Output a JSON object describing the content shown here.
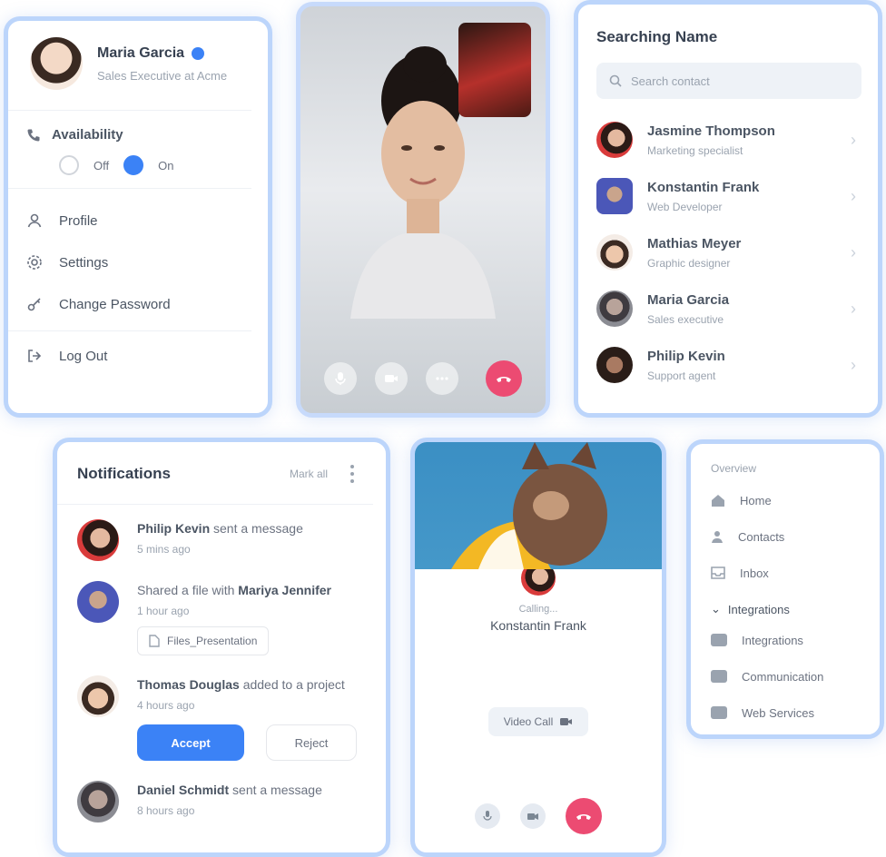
{
  "profile": {
    "name": "Maria Garcia",
    "subtitle": "Sales Executive at Acme",
    "availability_label": "Availability",
    "radio_off": "Off",
    "radio_on": "On",
    "menu": [
      "Profile",
      "Settings",
      "Change Password"
    ],
    "logout": "Log Out"
  },
  "contacts": {
    "title": "Searching Name",
    "search_placeholder": "Search contact",
    "items": [
      {
        "name": "Jasmine Thompson",
        "sub": "Marketing specialist"
      },
      {
        "name": "Konstantin Frank",
        "sub": "Web Developer"
      },
      {
        "name": "Mathias Meyer",
        "sub": "Graphic designer"
      },
      {
        "name": "Maria Garcia",
        "sub": "Sales executive"
      },
      {
        "name": "Philip Kevin",
        "sub": "Support agent"
      }
    ]
  },
  "notifications": {
    "title": "Notifications",
    "mark_all": "Mark all",
    "items": [
      {
        "actor": "Philip Kevin",
        "action": "sent a message",
        "time": "5 mins ago"
      },
      {
        "pre": "Shared a file with",
        "actor": "Mariya Jennifer",
        "time": "1 hour ago",
        "file": "Files_Presentation"
      },
      {
        "actor": "Thomas Douglas",
        "action": "added to a project",
        "time": "4 hours ago",
        "accept": "Accept",
        "reject": "Reject"
      },
      {
        "actor": "Daniel Schmidt",
        "action": "sent a message",
        "time": "8 hours ago"
      }
    ]
  },
  "incoming": {
    "label": "Calling...",
    "name": "Konstantin Frank",
    "chip": "Video Call"
  },
  "navcard": {
    "label": "Overview",
    "items": [
      "Home",
      "Contacts",
      "Inbox"
    ],
    "group": "Integrations",
    "group_items": [
      "Integrations",
      "Communication",
      "Web Services"
    ]
  },
  "colors": {
    "accent": "#3b82f6",
    "danger": "#ec4b72",
    "card_border": "#bcd5fb"
  }
}
